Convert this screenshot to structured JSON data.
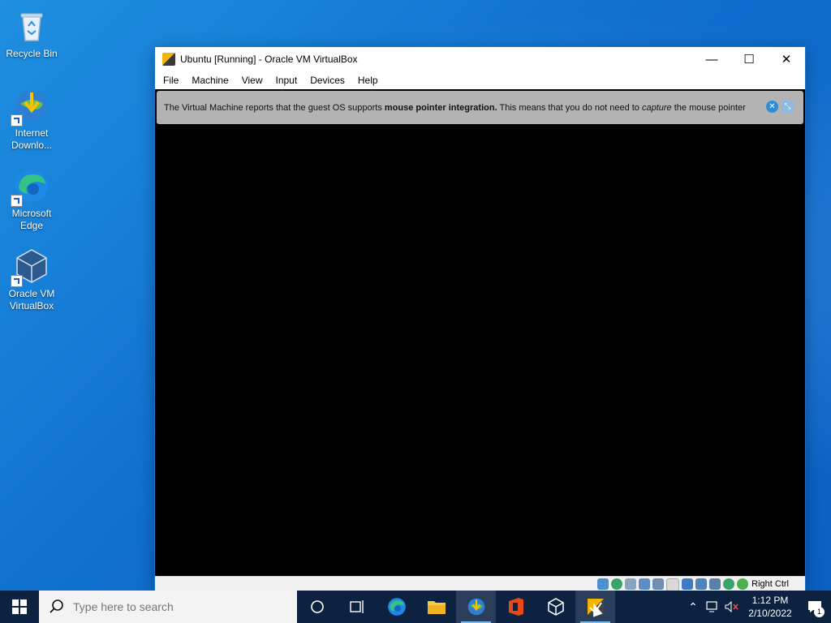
{
  "desktop": {
    "icons": [
      {
        "label": "Recycle Bin"
      },
      {
        "label": "Internet Downlo..."
      },
      {
        "label": "Microsoft Edge"
      },
      {
        "label": "Oracle VM VirtualBox"
      }
    ]
  },
  "window": {
    "title": "Ubuntu [Running] - Oracle VM VirtualBox",
    "controls": {
      "minimize": "—",
      "maximize": "☐",
      "close": "✕"
    },
    "menu": [
      "File",
      "Machine",
      "View",
      "Input",
      "Devices",
      "Help"
    ],
    "notice": {
      "part1": "The Virtual Machine reports that the guest OS supports ",
      "bold": "mouse pointer integration.",
      "part2": " This means that you do not need to ",
      "italic": "capture",
      "part3": " the mouse pointer"
    },
    "status": {
      "host_key": "Right Ctrl"
    }
  },
  "taskbar": {
    "search_placeholder": "Type here to search",
    "clock": {
      "time": "1:12 PM",
      "date": "2/10/2022"
    },
    "notification_count": "1"
  },
  "colors": {
    "accent": "#0078d7",
    "taskbar": "#0c2240",
    "vm_screen": "#000000"
  }
}
